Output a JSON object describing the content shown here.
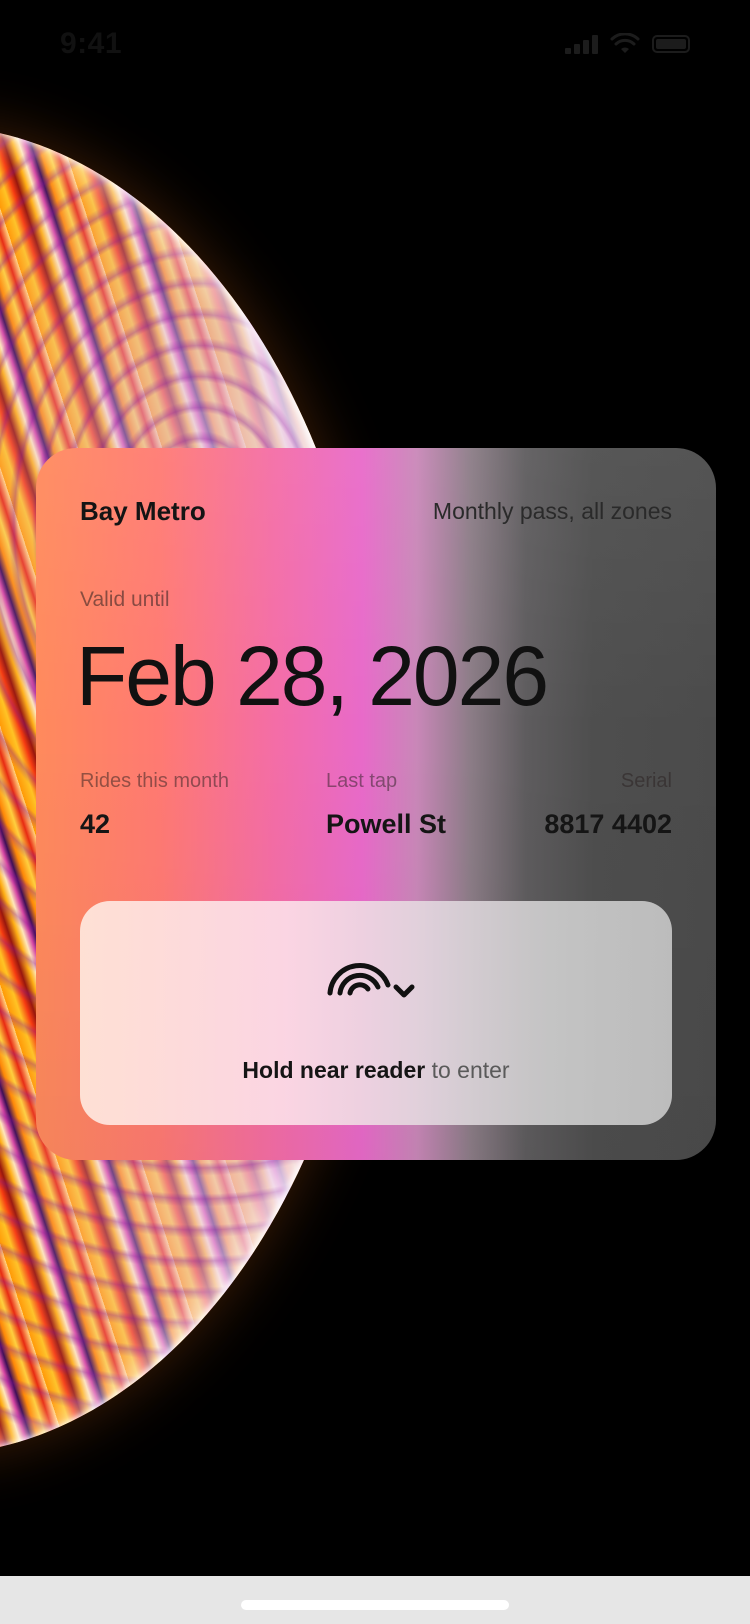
{
  "status_bar": {
    "time": "9:41",
    "icons": [
      "cellular-signal-icon",
      "wifi-icon",
      "battery-icon"
    ]
  },
  "pass": {
    "agency": "Bay Metro",
    "type": "Monthly pass, all zones",
    "valid_label": "Valid until",
    "valid_date": "Feb 28, 2026",
    "stats": {
      "rides_label": "Rides this month",
      "rides_value": "42",
      "last_tap_label": "Last tap",
      "last_tap_value": "Powell St",
      "serial_label": "Serial",
      "serial_value": "8817 4402"
    },
    "tap": {
      "icon": "nfc-contactless-icon",
      "action_bold": "Hold near reader",
      "action_rest": "to enter"
    }
  },
  "colors": {
    "card_gradient_start": "#ff8a5c",
    "card_gradient_mid": "#e86ac9",
    "card_gradient_end": "#4b4b4b",
    "background": "#000000"
  }
}
